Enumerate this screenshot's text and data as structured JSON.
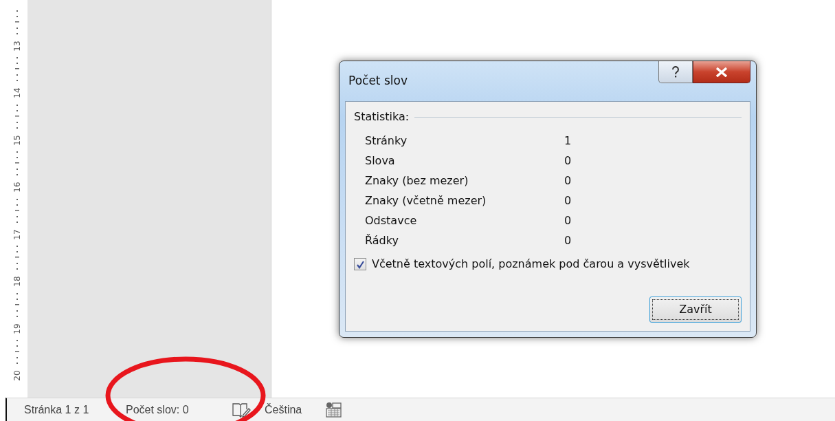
{
  "ruler": {
    "labels": [
      "13",
      "14",
      "15",
      "16",
      "17",
      "18",
      "19",
      "20"
    ]
  },
  "dialog": {
    "title": "Počet slov",
    "group_label": "Statistika:",
    "stats": [
      {
        "label": "Stránky",
        "value": "1"
      },
      {
        "label": "Slova",
        "value": "0"
      },
      {
        "label": "Znaky (bez mezer)",
        "value": "0"
      },
      {
        "label": "Znaky (včetně mezer)",
        "value": "0"
      },
      {
        "label": "Odstavce",
        "value": "0"
      },
      {
        "label": "Řádky",
        "value": "0"
      }
    ],
    "checkbox": {
      "label": "Včetně textových polí, poznámek pod čarou a vysvětlivek",
      "checked": true
    },
    "close_button": "Zavřít"
  },
  "status_bar": {
    "page": "Stránka 1 z 1",
    "words": "Počet slov: 0",
    "language": "Čeština"
  }
}
